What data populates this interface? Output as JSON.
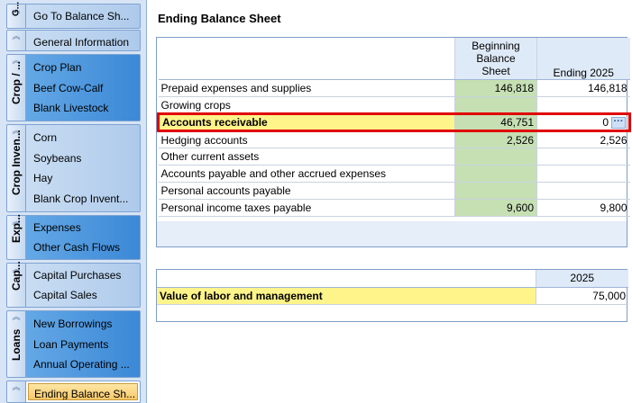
{
  "nav": {
    "groups": [
      {
        "title": "G...",
        "items": [
          "Go To Balance Sh..."
        ]
      },
      {
        "title": "",
        "items": [
          "General Information"
        ]
      },
      {
        "title": "Crop / ...",
        "items": [
          "Crop Plan",
          "Beef Cow-Calf",
          "Blank Livestock"
        ]
      },
      {
        "title": "Crop Inven...",
        "items": [
          "Corn",
          "Soybeans",
          "Hay",
          "Blank Crop Invent..."
        ]
      },
      {
        "title": "Exp...",
        "items": [
          "Expenses",
          "Other Cash Flows"
        ]
      },
      {
        "title": "Cap...",
        "items": [
          "Capital Purchases",
          "Capital Sales"
        ]
      },
      {
        "title": "Loans",
        "items": [
          "New Borrowings",
          "Loan Payments",
          "Annual Operating ..."
        ]
      },
      {
        "title": "",
        "items": [
          "Ending Balance Sh..."
        ]
      }
    ]
  },
  "page": {
    "title": "Ending Balance Sheet"
  },
  "balance_table": {
    "headers": [
      "",
      "Beginning Balance Sheet",
      "Ending 2025"
    ],
    "rows": [
      {
        "label": "Prepaid expenses and supplies",
        "beginning": "146,818",
        "ending": "146,818"
      },
      {
        "label": "Growing crops",
        "beginning": "",
        "ending": ""
      },
      {
        "label": "Accounts receivable",
        "beginning": "46,751",
        "ending": "0"
      },
      {
        "label": "Hedging accounts",
        "beginning": "2,526",
        "ending": "2,526"
      },
      {
        "label": "Other current assets",
        "beginning": "",
        "ending": ""
      },
      {
        "label": "Accounts payable and other accrued expenses",
        "beginning": "",
        "ending": ""
      },
      {
        "label": "Personal accounts payable",
        "beginning": "",
        "ending": ""
      },
      {
        "label": "Personal income taxes payable",
        "beginning": "9,600",
        "ending": "9,800"
      }
    ]
  },
  "labor_table": {
    "header": "2025",
    "label": "Value of labor and management",
    "value": "75,000"
  },
  "colors": {
    "highlight": "#e00000",
    "yellow": "#fff48a",
    "green_cell": "#c6e0b4",
    "nav_blue": "#3b88d6"
  },
  "icons": {
    "collapse": "double-chevron-icon",
    "ellipsis": "ellipsis-icon"
  }
}
